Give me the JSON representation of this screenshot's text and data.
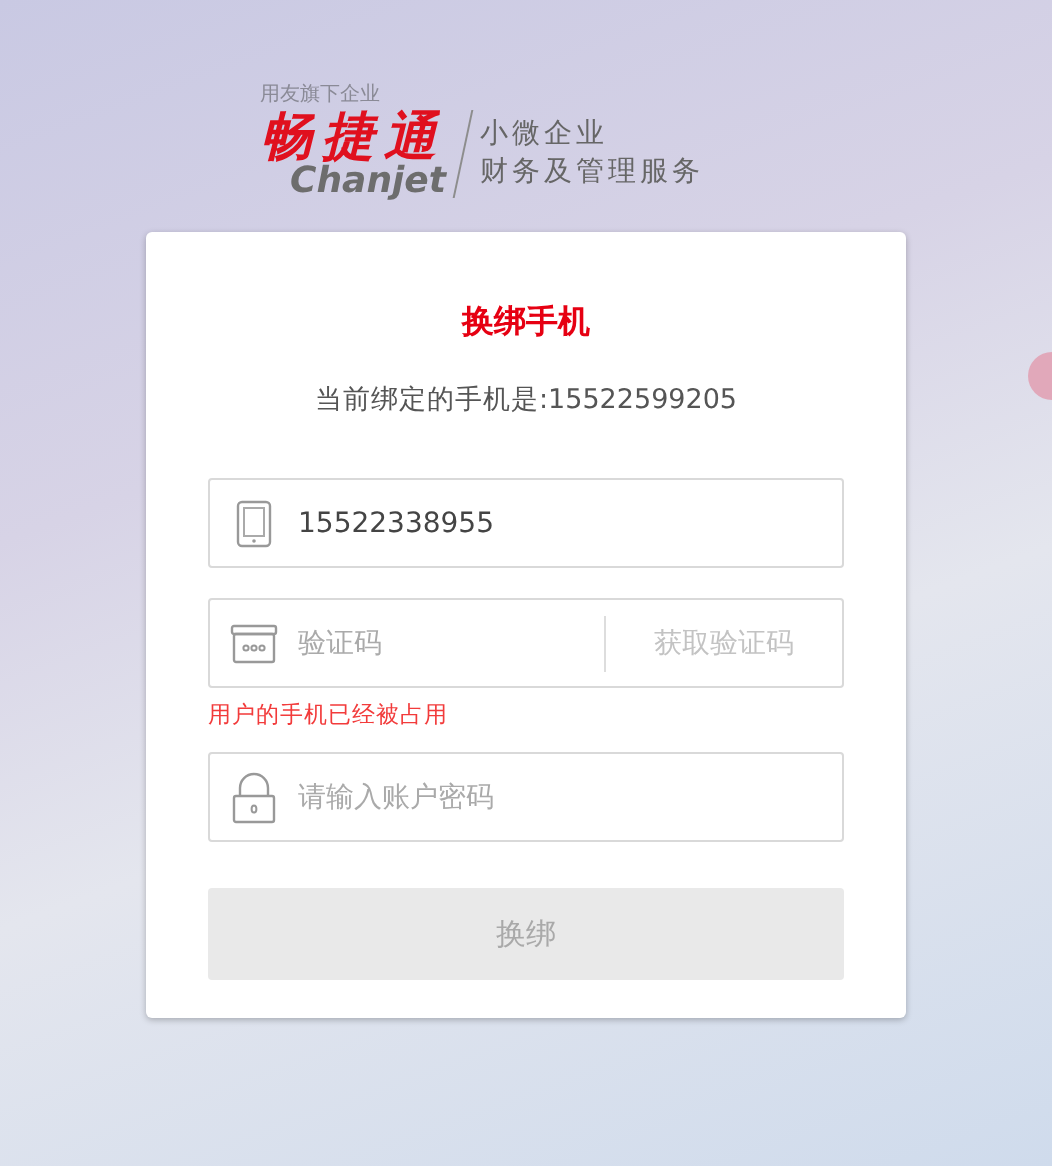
{
  "logo": {
    "tagline": "用友旗下企业",
    "brand": "畅捷通",
    "brand_latin": "Chanjet",
    "slogan_lines": [
      "小微企业",
      "财务及管理服务"
    ]
  },
  "card": {
    "title": "换绑手机",
    "current_phone": "当前绑定的手机是:15522599205",
    "fields": [
      {
        "kind": "phone",
        "value": "15522338955"
      },
      {
        "kind": "code",
        "placeholder": "验证码",
        "action": {
          "label": "获取验证码",
          "disabled": true
        },
        "error": "用户的手机已经被占用"
      },
      {
        "kind": "password",
        "placeholder": "请输入账户密码"
      }
    ],
    "submit": {
      "label": "换绑",
      "disabled": true
    }
  }
}
